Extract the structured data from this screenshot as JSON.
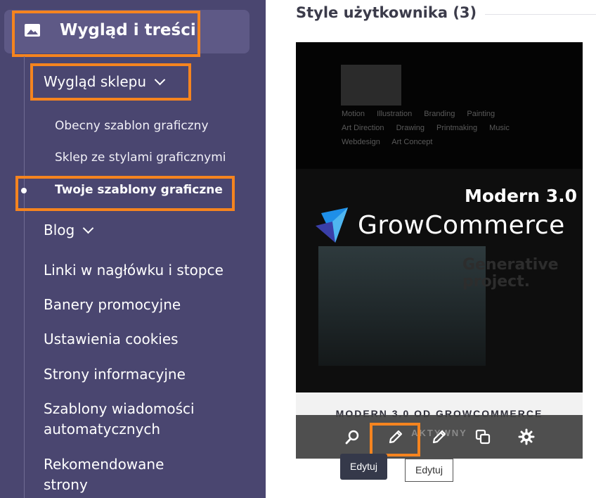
{
  "sidebar": {
    "section_title": "Wygląd i treści",
    "section_icon": "image-icon",
    "subsection": {
      "label": "Wygląd sklepu",
      "items": [
        {
          "label": "Obecny szablon graficzny"
        },
        {
          "label": "Sklep ze stylami graficznymi"
        },
        {
          "label": "Twoje szablony graficzne",
          "active": true
        }
      ]
    },
    "blog_label": "Blog",
    "nav_items": [
      {
        "label": "Linki w nagłówku i stopce"
      },
      {
        "label": "Banery promocyjne"
      },
      {
        "label": "Ustawienia cookies"
      },
      {
        "label": "Strony informacyjne"
      },
      {
        "label": "Szablony wiadomości automatycznych"
      },
      {
        "label": "Rekomendowane strony"
      }
    ]
  },
  "main": {
    "title": "Style użytkownika (3)",
    "card": {
      "preview_tags": [
        "Motion",
        "Illustration",
        "Branding",
        "Painting",
        "Art Direction",
        "Drawing",
        "Printmaking",
        "Music",
        "Webdesign",
        "Art Concept"
      ],
      "preview_heading": "Generative project.",
      "brand_version": "Modern 3.0",
      "brand_name": "GrowCommerce",
      "name": "MODERN 3.0 OD GROWCOMMERCE",
      "status": "AKTYWNY",
      "toolbar_icons": [
        "search-icon",
        "pencil-icon",
        "pencil-icon",
        "copy-icon",
        "gear-icon"
      ]
    },
    "tooltip_dark": "Edytuj",
    "tooltip_light": "Edytuj"
  },
  "colors": {
    "sidebar_bg": "#4a4670",
    "sidebar_active_bg": "#5e5986",
    "highlight": "#f5841f",
    "logo_blue": "#1e8fe8"
  }
}
